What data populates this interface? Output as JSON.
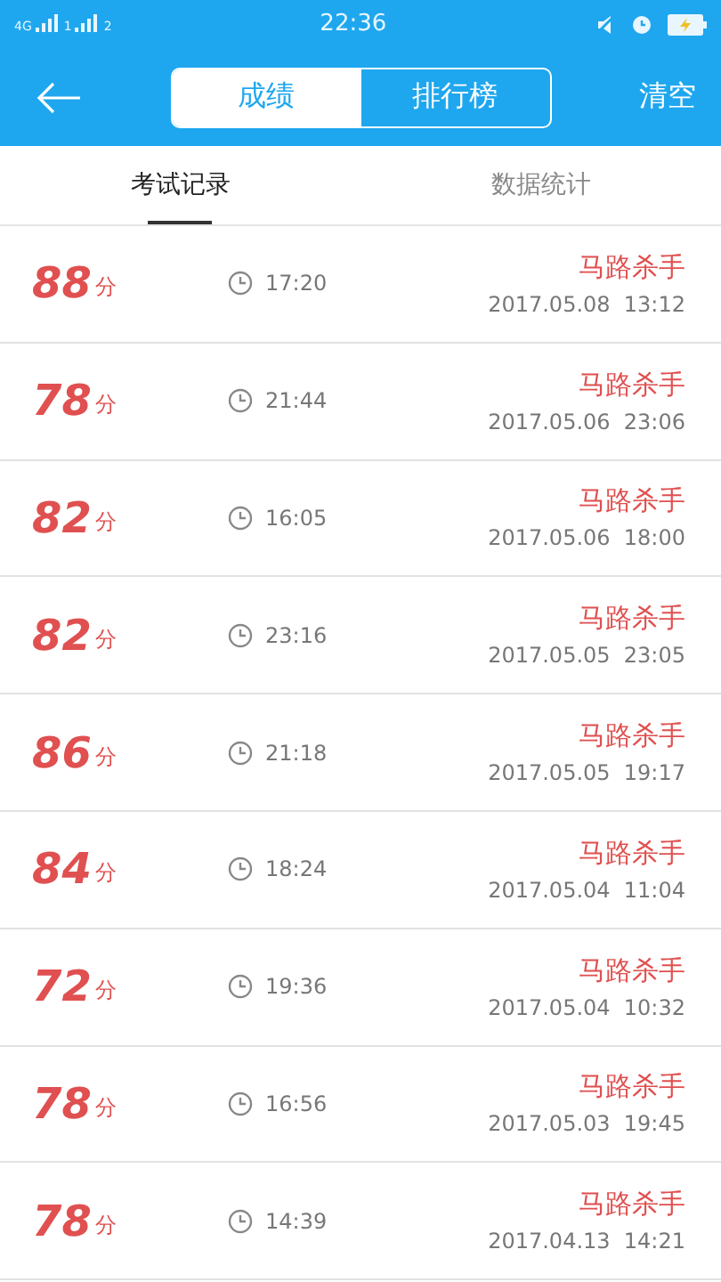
{
  "status_bar": {
    "network": "4G",
    "sims": [
      "1",
      "2"
    ],
    "time": "22:36"
  },
  "header": {
    "segments": [
      {
        "label": "成绩",
        "selected": true
      },
      {
        "label": "排行榜",
        "selected": false
      }
    ],
    "action": "清空"
  },
  "tabs": [
    {
      "label": "考试记录",
      "selected": true
    },
    {
      "label": "数据统计",
      "selected": false
    }
  ],
  "records": [
    {
      "score": "88",
      "unit": "分",
      "duration": "17:20",
      "name": "马路杀手",
      "date": "2017.05.08  13:12"
    },
    {
      "score": "78",
      "unit": "分",
      "duration": "21:44",
      "name": "马路杀手",
      "date": "2017.05.06  23:06"
    },
    {
      "score": "82",
      "unit": "分",
      "duration": "16:05",
      "name": "马路杀手",
      "date": "2017.05.06  18:00"
    },
    {
      "score": "82",
      "unit": "分",
      "duration": "23:16",
      "name": "马路杀手",
      "date": "2017.05.05  23:05"
    },
    {
      "score": "86",
      "unit": "分",
      "duration": "21:18",
      "name": "马路杀手",
      "date": "2017.05.05  19:17"
    },
    {
      "score": "84",
      "unit": "分",
      "duration": "18:24",
      "name": "马路杀手",
      "date": "2017.05.04  11:04"
    },
    {
      "score": "72",
      "unit": "分",
      "duration": "19:36",
      "name": "马路杀手",
      "date": "2017.05.04  10:32"
    },
    {
      "score": "78",
      "unit": "分",
      "duration": "16:56",
      "name": "马路杀手",
      "date": "2017.05.03  19:45"
    },
    {
      "score": "78",
      "unit": "分",
      "duration": "14:39",
      "name": "马路杀手",
      "date": "2017.04.13  14:21"
    }
  ]
}
